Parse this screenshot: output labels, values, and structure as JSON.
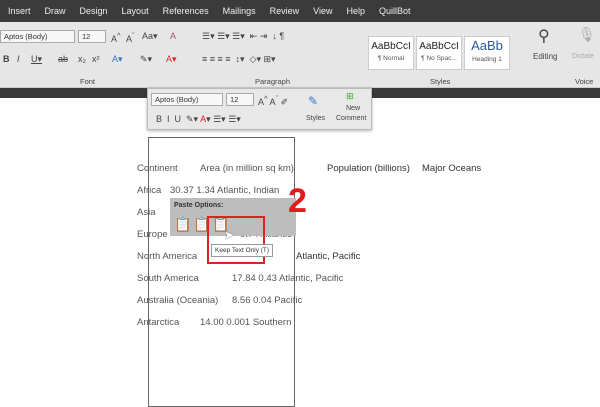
{
  "tabs": [
    "Insert",
    "Draw",
    "Design",
    "Layout",
    "References",
    "Mailings",
    "Review",
    "View",
    "Help",
    "QuillBot"
  ],
  "ribbon": {
    "font_name": "Aptos (Body)",
    "font_size": "12",
    "groups": {
      "font": "Font",
      "paragraph": "Paragraph",
      "styles": "Styles",
      "voice": "Voice"
    },
    "styles": [
      {
        "preview": "AaBbCcI",
        "name": "¶ Normal"
      },
      {
        "preview": "AaBbCcI",
        "name": "¶ No Spac..."
      },
      {
        "preview": "AaBb",
        "name": "Heading 1"
      }
    ],
    "editing": "Editing",
    "dictate": "Dictate"
  },
  "mini_toolbar": {
    "font_name": "Aptos (Body)",
    "font_size": "12",
    "styles": "Styles",
    "new_comment_1": "New",
    "new_comment_2": "Comment"
  },
  "document": {
    "header": {
      "c1": "Continent",
      "c2": "Area (in million sq km)",
      "c3": "Population (billions)",
      "c4": "Major Oceans"
    },
    "rows": [
      {
        "name": "Africa",
        "rest": "30.37  1.34   Atlantic, Indian"
      },
      {
        "name": "Asia",
        "rest": ""
      },
      {
        "name": "Europe",
        "rest": "0.74   Atlantic"
      },
      {
        "name": "North America",
        "rest": "Atlantic, Pacific"
      },
      {
        "name": "South America",
        "rest": "17.84  0.43   Atlantic, Pacific"
      },
      {
        "name": "Australia (Oceania)",
        "rest": "8.56   0.04   Pacific"
      },
      {
        "name": "Antarctica",
        "rest": "14.00  0.001  Southern"
      }
    ]
  },
  "paste": {
    "title": "Paste Options:",
    "tooltip": "Keep Text Only (T)"
  },
  "annotation": "2"
}
